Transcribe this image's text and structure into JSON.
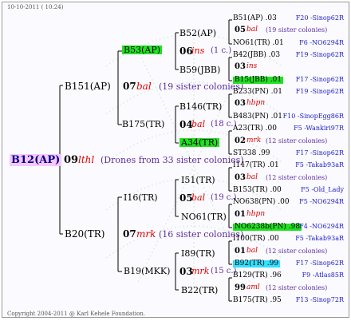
{
  "header_date": "10-10-2011 ( 10:24)",
  "footer": "Copyright 2004-2011 @ Karl Kehele Foundation.",
  "root": {
    "name": "B12(AP)",
    "gen_num": "09",
    "gen_code": "lthl",
    "note": "(Drones from 33 sister colonies)"
  },
  "l1": {
    "top": {
      "name": "B151(AP)",
      "gen_num": "07",
      "gen_code": "bal",
      "note": "(19 sister colonies)"
    },
    "bottom": {
      "name": "B20(TR)",
      "gen_num": "07",
      "gen_code": "mrk",
      "note": "(16 sister colonies)"
    }
  },
  "l2": {
    "b53": {
      "name": "B53(AP)",
      "gen_num": "06",
      "gen_code": "ins",
      "note": "(1 c.)"
    },
    "b175": {
      "name": "B175(TR)",
      "gen_num": "04",
      "gen_code": "bal",
      "note": "(18 c.)"
    },
    "i16": {
      "name": "I16(TR)",
      "gen_num": "05",
      "gen_code": "bal",
      "note": "(19 c.)"
    },
    "b19": {
      "name": "B19(MKK)",
      "gen_num": "03",
      "gen_code": "mrk",
      "note": "(15 c.)"
    }
  },
  "l3": {
    "b52": "B52(AP)",
    "b59": "B59(JBB)",
    "b146": "B146(TR)",
    "a34": "A34(TR)",
    "i51": "I51(TR)",
    "no61": "NO61(TR)",
    "i89": "I89(TR)",
    "b22": "B22(TR)"
  },
  "right": [
    {
      "a": "B51(AP) .03",
      "b": "F20 -Sinop62R"
    },
    {
      "num": "05",
      "code": "bal",
      "note": "(19 sister colonies)"
    },
    {
      "a": "NO61(TR) .01",
      "b": "F6 -NO6294R"
    },
    {
      "a": "B42(JBB) .03",
      "b": "F19 -Sinop62R"
    },
    {
      "num": "03",
      "code": "ins"
    },
    {
      "a": "B15(JBB) .01",
      "b": "F17 -Sinop62R",
      "hl": "green"
    },
    {
      "a": "B233(PN) .01",
      "b": "F19 -Sinop62R"
    },
    {
      "num": "03",
      "code": "hbpn"
    },
    {
      "a": "B483(PN) .01",
      "b": "F10 -SinopEgg86R"
    },
    {
      "a": "A23(TR) .00",
      "b": "F5 -Wankiri97R"
    },
    {
      "num": "02",
      "code": "mrk",
      "note": "(12 sister colonies)"
    },
    {
      "a": "ST338 .99",
      "b": "F17 -Sinop62R"
    },
    {
      "a": "I147(TR) .01",
      "b": "F5 -Takab93aR"
    },
    {
      "num": "03",
      "code": "bal",
      "note": "(12 sister colonies)"
    },
    {
      "a": "B153(TR) .00",
      "b": "F5 -Old_Lady"
    },
    {
      "a": "NO638(PN) .00",
      "b": "F5 -NO6294R"
    },
    {
      "num": "01",
      "code": "hbpn"
    },
    {
      "a": "NO6238b(PN) .98",
      "b": "F4 -NO6294R",
      "hl": "green"
    },
    {
      "a": "I100(TR) .00",
      "b": "F5 -Takab93aR"
    },
    {
      "num": "01",
      "code": "bal",
      "note": "(12 sister colonies)"
    },
    {
      "a": "B92(TR) .99",
      "b": "F17 -Sinop62R",
      "hl": "cyan"
    },
    {
      "a": "B129(TR) .96",
      "b": "F9 -Atlas85R"
    },
    {
      "num": "99",
      "code": "aml",
      "note": "(12 sister colonies)"
    },
    {
      "a": "B175(TR) .95",
      "b": "F13 -Sinop72R"
    }
  ]
}
